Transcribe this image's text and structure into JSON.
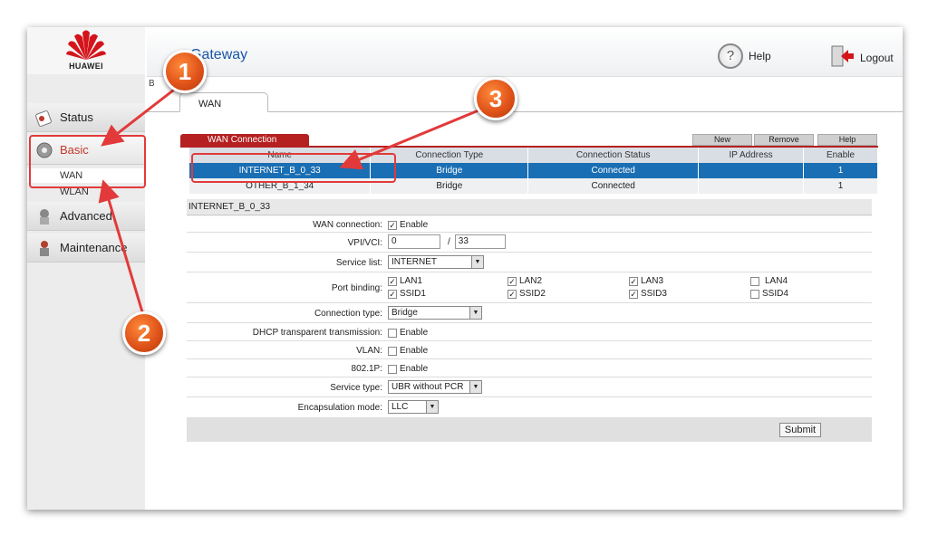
{
  "sidebar": {
    "brand": "HUAWEI",
    "items": [
      {
        "label": "Status"
      },
      {
        "label": "Basic"
      },
      {
        "label": "Advanced"
      },
      {
        "label": "Maintenance"
      }
    ],
    "sub_items": [
      "WAN",
      "WLAN"
    ]
  },
  "header": {
    "title": "Gateway",
    "help_label": "Help",
    "logout_label": "Logout",
    "breadcrumb": "B"
  },
  "tabs": [
    {
      "label": "WAN"
    }
  ],
  "connections": {
    "tab_label": "WAN Connection",
    "buttons": {
      "new": "New",
      "remove": "Remove",
      "help": "Help"
    },
    "columns": [
      "Name",
      "Connection Type",
      "Connection Status",
      "IP Address",
      "Enable"
    ],
    "rows": [
      {
        "name": "INTERNET_B_0_33",
        "type": "Bridge",
        "status": "Connected",
        "ip": "",
        "enable": "1"
      },
      {
        "name": "OTHER_B_1_34",
        "type": "Bridge",
        "status": "Connected",
        "ip": "",
        "enable": "1"
      }
    ]
  },
  "config": {
    "header": "INTERNET_B_0_33",
    "wan_connection_label": "WAN connection:",
    "enable_text": "Enable",
    "vpivci_label": "VPI/VCI:",
    "vpi": "0",
    "vci": "33",
    "vci_sep": "/",
    "service_list_label": "Service list:",
    "service_list_value": "INTERNET",
    "port_binding_label": "Port binding:",
    "ports": [
      {
        "label": "LAN1",
        "checked": true
      },
      {
        "label": "LAN2",
        "checked": true
      },
      {
        "label": "LAN3",
        "checked": true
      },
      {
        "label": "LAN4",
        "checked": false
      },
      {
        "label": "SSID1",
        "checked": true
      },
      {
        "label": "SSID2",
        "checked": true
      },
      {
        "label": "SSID3",
        "checked": true
      },
      {
        "label": "SSID4",
        "checked": false
      }
    ],
    "connection_type_label": "Connection type:",
    "connection_type_value": "Bridge",
    "dhcp_label": "DHCP transparent transmission:",
    "vlan_label": "VLAN:",
    "dot1p_label": "802.1P:",
    "service_type_label": "Service type:",
    "service_type_value": "UBR without PCR",
    "encap_label": "Encapsulation mode:",
    "encap_value": "LLC",
    "submit_label": "Submit"
  },
  "annotations": [
    "1",
    "2",
    "3"
  ],
  "colors": {
    "accent_red": "#b52020",
    "selection_blue": "#1a6eb3",
    "highlight_red": "#e23a3a",
    "badge_orange": "#e0541a"
  }
}
